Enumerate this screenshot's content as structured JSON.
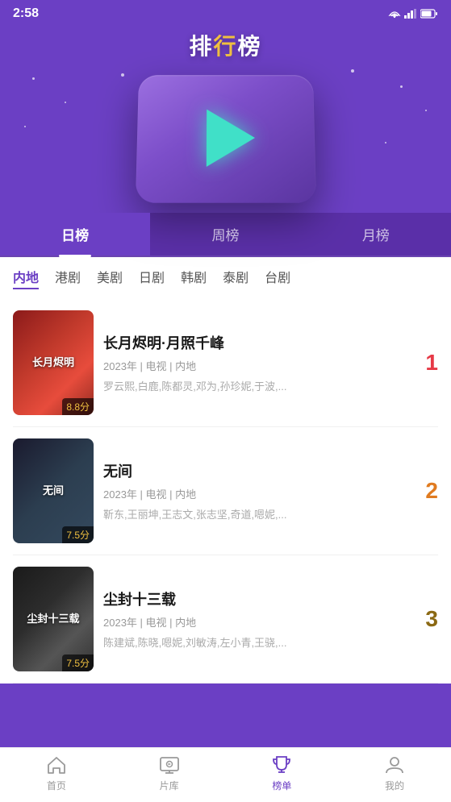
{
  "statusBar": {
    "time": "2:58",
    "icons": [
      "wifi",
      "signal",
      "battery"
    ]
  },
  "header": {
    "title": "排行榜",
    "titleHighlight": "行"
  },
  "tabs": [
    {
      "id": "daily",
      "label": "日榜",
      "active": true
    },
    {
      "id": "weekly",
      "label": "周榜",
      "active": false
    },
    {
      "id": "monthly",
      "label": "月榜",
      "active": false
    }
  ],
  "categories": [
    {
      "id": "mainland",
      "label": "内地",
      "active": true
    },
    {
      "id": "hk",
      "label": "港剧",
      "active": false
    },
    {
      "id": "us",
      "label": "美剧",
      "active": false
    },
    {
      "id": "jp",
      "label": "日剧",
      "active": false
    },
    {
      "id": "kr",
      "label": "韩剧",
      "active": false
    },
    {
      "id": "th",
      "label": "泰剧",
      "active": false
    },
    {
      "id": "tw",
      "label": "台剧",
      "active": false
    }
  ],
  "items": [
    {
      "rank": "1",
      "rankClass": "rank-1",
      "title": "长月烬明·月照千峰",
      "meta": "2023年 | 电视 | 内地",
      "cast": "罗云熙,白鹿,陈都灵,邓为,孙珍妮,于波,...",
      "score": "8.8分",
      "thumbClass": "thumb-1",
      "posterTitle": "长月烬明"
    },
    {
      "rank": "2",
      "rankClass": "rank-2",
      "title": "无间",
      "meta": "2023年 | 电视 | 内地",
      "cast": "靳东,王丽坤,王志文,张志坚,奇道,嗯妮,...",
      "score": "7.5分",
      "thumbClass": "thumb-2",
      "posterTitle": "无间"
    },
    {
      "rank": "3",
      "rankClass": "rank-3",
      "title": "尘封十三载",
      "meta": "2023年 | 电视 | 内地",
      "cast": "陈建斌,陈晓,嗯妮,刘敏涛,左小青,王骁,...",
      "score": "7.5分",
      "thumbClass": "thumb-3",
      "posterTitle": "尘封十三载"
    }
  ],
  "bottomNav": [
    {
      "id": "home",
      "icon": "⌂",
      "label": "首页",
      "active": false
    },
    {
      "id": "library",
      "icon": "📺",
      "label": "片库",
      "active": false
    },
    {
      "id": "ranking",
      "icon": "🏆",
      "label": "榜单",
      "active": true
    },
    {
      "id": "mine",
      "icon": "👤",
      "label": "我的",
      "active": false
    }
  ]
}
